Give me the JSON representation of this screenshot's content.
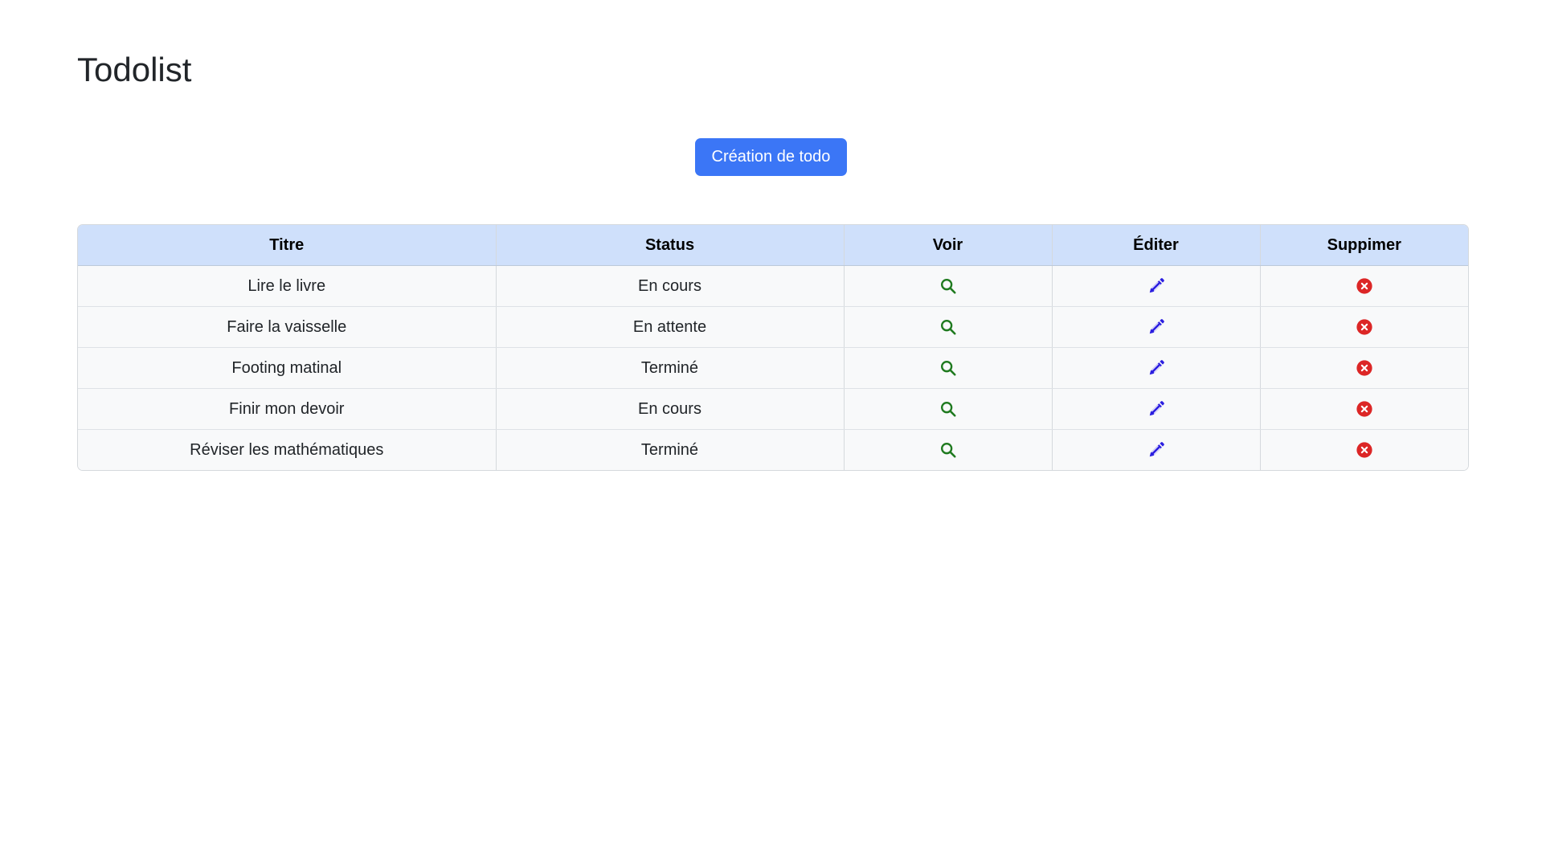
{
  "page": {
    "title": "Todolist",
    "create_button_label": "Création de todo"
  },
  "table": {
    "headers": [
      "Titre",
      "Status",
      "Voir",
      "Éditer",
      "Suppimer"
    ],
    "rows": [
      {
        "title": "Lire le livre",
        "status": "En cours"
      },
      {
        "title": "Faire la vaisselle",
        "status": "En attente"
      },
      {
        "title": "Footing matinal",
        "status": "Terminé"
      },
      {
        "title": "Finir mon devoir",
        "status": "En cours"
      },
      {
        "title": "Réviser les mathématiques",
        "status": "Terminé"
      }
    ],
    "row_actions": {
      "view_icon": "search-icon",
      "edit_icon": "pencil-icon",
      "delete_icon": "close-circle-icon"
    }
  },
  "colors": {
    "primary": "#3b76f6",
    "header_bg": "#cfe0fb",
    "view_icon": "#1f7a1f",
    "edit_icon": "#2b1ee0",
    "delete_icon": "#dc2626"
  }
}
